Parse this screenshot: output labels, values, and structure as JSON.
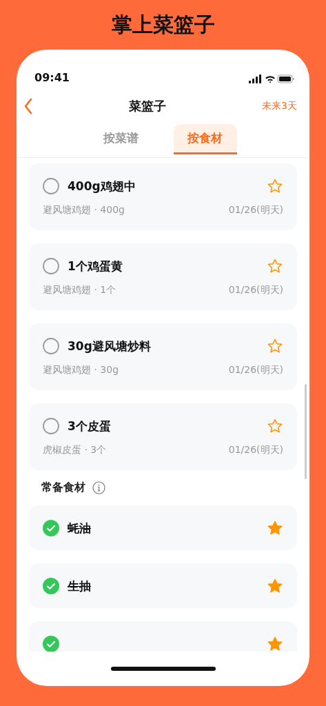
{
  "app_title": "掌上菜篮子",
  "status_bar": {
    "time": "09:41"
  },
  "nav": {
    "title": "菜篮子",
    "action": "未来3天"
  },
  "tabs": [
    {
      "label": "按菜谱",
      "selected": false
    },
    {
      "label": "按食材",
      "selected": true
    }
  ],
  "items": [
    {
      "name": "400g鸡翅中",
      "detail": "避风塘鸡翅 · 400g",
      "date": "01/26(明天)",
      "checked": false,
      "starred": false
    },
    {
      "name": "1个鸡蛋黄",
      "detail": "避风塘鸡翅 · 1个",
      "date": "01/26(明天)",
      "checked": false,
      "starred": false
    },
    {
      "name": "30g避风塘炒料",
      "detail": "避风塘鸡翅 · 30g",
      "date": "01/26(明天)",
      "checked": false,
      "starred": false
    },
    {
      "name": "3个皮蛋",
      "detail": "虎椒皮蛋 · 3个",
      "date": "01/26(明天)",
      "checked": false,
      "starred": false
    }
  ],
  "staples": {
    "title": "常备食材",
    "items": [
      {
        "name": "蚝油",
        "checked": true,
        "starred": true
      },
      {
        "name": "生抽",
        "checked": true,
        "starred": true
      },
      {
        "checked": true,
        "starred": true
      }
    ]
  }
}
